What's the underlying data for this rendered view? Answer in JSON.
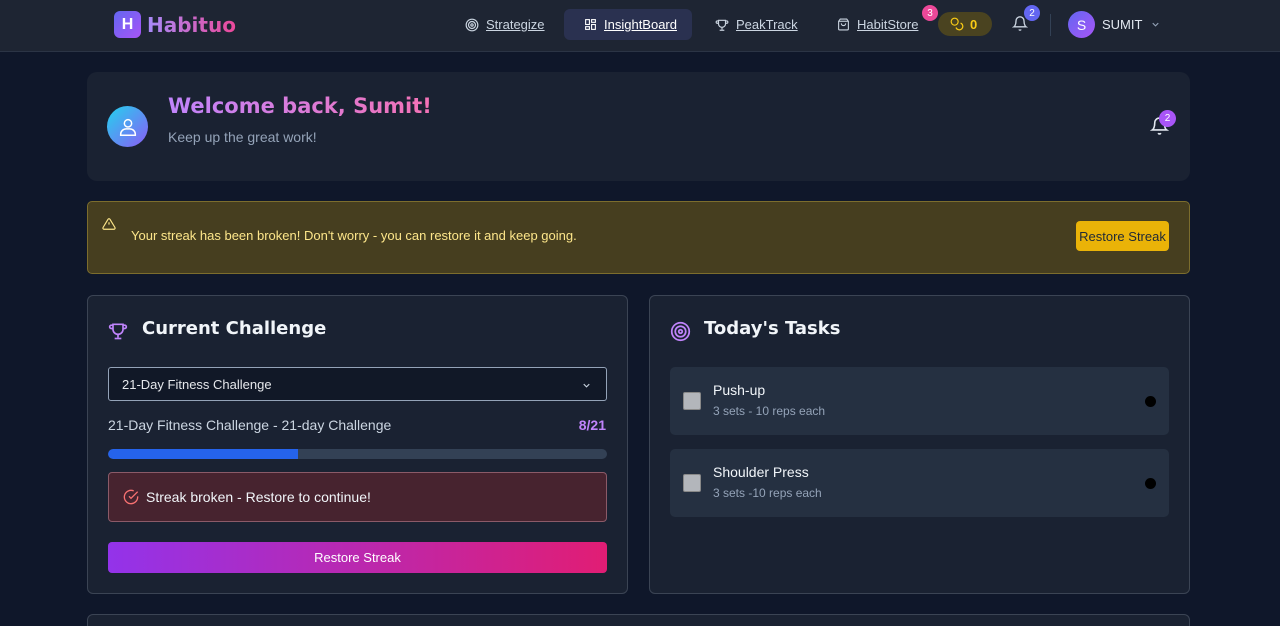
{
  "app": {
    "logo_letter": "H",
    "name": "Habituo"
  },
  "nav": {
    "items": [
      {
        "label": "Strategize",
        "icon": "target-icon"
      },
      {
        "label": "InsightBoard",
        "icon": "dashboard-icon",
        "active": true
      },
      {
        "label": "PeakTrack",
        "icon": "trophy-icon"
      },
      {
        "label": "HabitStore",
        "icon": "shopping-bag-icon"
      }
    ],
    "store_badge": "3",
    "coins": "0",
    "notifications_badge": "2",
    "user_initial": "S",
    "user_name": "SUMIT"
  },
  "welcome": {
    "title": "Welcome back, Sumit!",
    "subtitle": "Keep up the great work!",
    "notifications_badge": "2"
  },
  "alert": {
    "message": "Your streak has been broken! Don't worry - you can restore it and keep going.",
    "button": "Restore Streak"
  },
  "challenge": {
    "title": "Current Challenge",
    "selected": "21-Day Fitness Challenge",
    "name": "21-Day Fitness Challenge - 21-day Challenge",
    "progress_text": "8/21",
    "progress": 0.381,
    "streak_message": "Streak broken - Restore to continue!",
    "button": "Restore Streak"
  },
  "tasks": {
    "title": "Today's Tasks",
    "items": [
      {
        "title": "Push-up",
        "desc": "3 sets - 10 reps each"
      },
      {
        "title": "Shoulder Press",
        "desc": "3 sets -10 reps each"
      }
    ]
  },
  "colors": {
    "accent": "#a855f7",
    "progress": "#2563eb",
    "warning": "#eab308",
    "background": "#0f172a"
  }
}
